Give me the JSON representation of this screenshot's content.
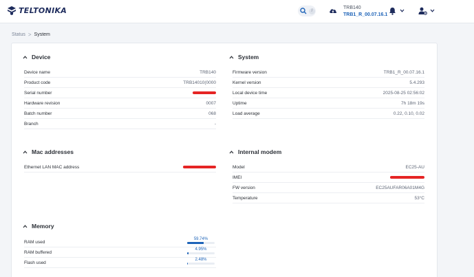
{
  "header": {
    "brand": "TELTONIKA",
    "device_name": "TRB140",
    "firmware": "TRB1_R_00.07.16.1",
    "search_hint": "/"
  },
  "breadcrumb": {
    "parent": "Status",
    "separator": ">",
    "current": "System"
  },
  "device": {
    "title": "Device",
    "rows": [
      {
        "label": "Device name",
        "value": "TRB140"
      },
      {
        "label": "Product code",
        "value": "TRB14010(0000"
      },
      {
        "label": "Serial number",
        "value": ""
      },
      {
        "label": "Hardware revision",
        "value": "0007"
      },
      {
        "label": "Batch number",
        "value": "068"
      },
      {
        "label": "Branch",
        "value": "-"
      }
    ]
  },
  "system": {
    "title": "System",
    "rows": [
      {
        "label": "Firmware version",
        "value": "TRB1_R_00.07.16.1"
      },
      {
        "label": "Kernel version",
        "value": "5.4.293"
      },
      {
        "label": "Local device time",
        "value": "2025-08-25 02:56:02"
      },
      {
        "label": "Uptime",
        "value": "7h 18m 19s"
      },
      {
        "label": "Load average",
        "value": "0.22, 0.10, 0.02"
      }
    ]
  },
  "mac": {
    "title": "Mac addresses",
    "rows": [
      {
        "label": "Ethernet LAN MAC address",
        "value": ""
      }
    ]
  },
  "modem": {
    "title": "Internal modem",
    "rows": [
      {
        "label": "Model",
        "value": "EC25-AU"
      },
      {
        "label": "IMEI",
        "value": ""
      },
      {
        "label": "FW version",
        "value": "EC25AUFAR06A01M4G"
      },
      {
        "label": "Temperature",
        "value": "53°C"
      }
    ]
  },
  "memory": {
    "title": "Memory",
    "rows": [
      {
        "label": "RAM used",
        "percent_label": "59.74%",
        "fraction": 0.5974
      },
      {
        "label": "RAM buffered",
        "percent_label": "4.95%",
        "fraction": 0.0495
      },
      {
        "label": "Flash used",
        "percent_label": "2.48%",
        "fraction": 0.0248
      }
    ]
  },
  "colors": {
    "accent": "#1d63b8",
    "redaction": "#e52424",
    "brand": "#1d2b5c"
  }
}
